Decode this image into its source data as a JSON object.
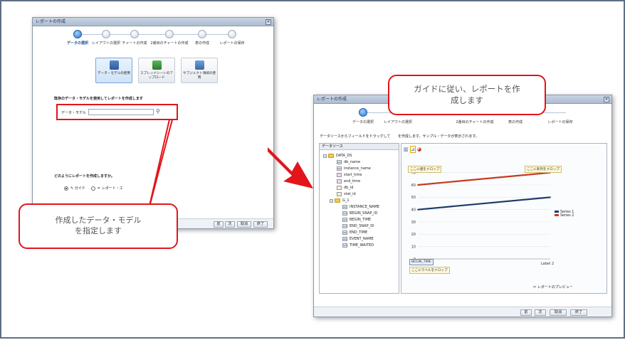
{
  "left_window": {
    "title": "レポートの作成",
    "steps": [
      "データの選択",
      "レイアウトの選択",
      "チャートの作成",
      "2番目のチャートの作成",
      "表の作成",
      "レポートの保存"
    ],
    "options": [
      {
        "label": "データ・モデルの使用",
        "icon": "data-model-icon"
      },
      {
        "label": "スプレッドシートのアップロード",
        "icon": "spreadsheet-icon"
      },
      {
        "label": "サブジェクト領域の使用",
        "icon": "subject-area-icon"
      }
    ],
    "prompt": "既存のデータ・モデルを使用してレポートを作成します",
    "data_model_label": "データ・モデル",
    "how_prompt": "どのようにレポートを作成しますか。",
    "radio_guide": "ガイド",
    "radio_editor": "レポート・エ",
    "buttons": [
      "前",
      "次",
      "取消",
      "終了"
    ]
  },
  "right_window": {
    "title": "レポートの作成",
    "steps": [
      "データの選択",
      "レイアウトの選択",
      "2番目のチャートの作成",
      "表の作成",
      "レポートの保存"
    ],
    "instruction": "データソースからフィールドをドラッグして",
    "instruction2": "を作成します。サンプル・データが表示されます。",
    "tree_header": "データソース",
    "tree": {
      "root": "DATA_DS",
      "fields1": [
        "db_name",
        "instance_name",
        "start_time",
        "end_time",
        "db_id",
        "stat_id"
      ],
      "group": "G_1",
      "fields2": [
        "INSTANCE_NAME",
        "BEGIN_SNAP_ID",
        "BEGIN_TIME",
        "END_SNAP_ID",
        "END_TIME",
        "EVENT_NAME",
        "TIME_WAITED"
      ]
    },
    "drop_value": "ここに値をドロップ",
    "drop_series": "ここに系列をドロップ",
    "drop_label": "ここにラベルをドロップ",
    "x_field": "BEGIN_TIME",
    "preview": "レポートのプレビュー",
    "buttons": [
      "前",
      "次",
      "取消",
      "終了"
    ]
  },
  "callout_left": "作成したデータ・モデル\nを指定します",
  "callout_right": "ガイドに従い、レポートを作\n成します",
  "chart_data": {
    "type": "line",
    "categories": [
      "",
      "Label 2"
    ],
    "series": [
      {
        "name": "Series 1",
        "values": [
          40,
          50
        ],
        "color": "#1f3b6b"
      },
      {
        "name": "Series 2",
        "values": [
          60,
          70
        ],
        "color": "#c8391e"
      }
    ],
    "yticks": [
      0,
      10,
      20,
      30,
      40,
      50,
      60,
      70
    ],
    "ylim": [
      0,
      75
    ],
    "grid": true,
    "legend": "right"
  },
  "colors": {
    "accent_red": "#e2151b",
    "frame": "#5e6f84"
  }
}
